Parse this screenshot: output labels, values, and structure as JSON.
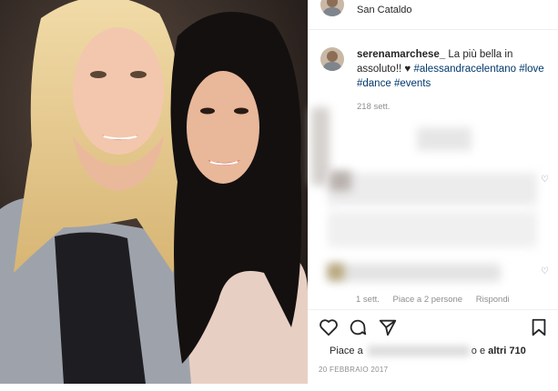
{
  "header": {
    "location": "San Cataldo"
  },
  "caption": {
    "username": "serenamarchese_",
    "text": " La più bella in assoluto!! ",
    "heart": "♥",
    "hashtags": [
      "#alessandracelentano",
      "#love",
      "#dance",
      "#events"
    ],
    "age": "218 sett."
  },
  "comment_meta": {
    "weeks": "1 sett.",
    "likes": "Piace a 2 persone",
    "reply": "Rispondi"
  },
  "likes": {
    "prefix": "Piace a",
    "suffix": "o e ",
    "others": "altri 710"
  },
  "date": "20 FEBBRAIO 2017",
  "icons": [
    "heart-icon",
    "comment-icon",
    "share-icon",
    "bookmark-icon"
  ]
}
